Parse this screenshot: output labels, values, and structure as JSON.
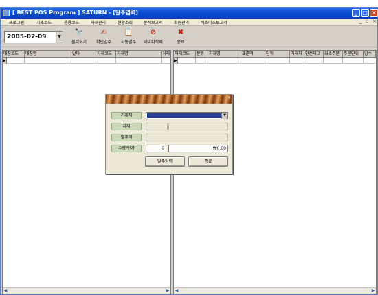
{
  "window": {
    "title": "[ BEST POS Program ]  SATURN  - [발주입력]",
    "controls": {
      "minimize": "_",
      "maximize": "□",
      "close": "×"
    }
  },
  "menu": {
    "items": [
      "프로그램",
      "기초코드",
      "응용코드",
      "자재관리",
      "현황조회",
      "분석보고서",
      "회원관리",
      "비즈니스보고서"
    ],
    "mdi_controls": [
      "_",
      "▫",
      "×"
    ]
  },
  "toolbar": {
    "date_value": "2005-02-09",
    "buttons": [
      {
        "label": "불러오기",
        "icon": "binoculars-icon",
        "glyph": "🔭"
      },
      {
        "label": "확인발주",
        "icon": "check-order-icon",
        "glyph": "✍"
      },
      {
        "label": "자동발주",
        "icon": "auto-order-icon",
        "glyph": "📋"
      },
      {
        "label": "데이타삭제",
        "icon": "delete-data-icon",
        "glyph": "⊘"
      },
      {
        "label": "종료",
        "icon": "exit-icon",
        "glyph": "✖"
      }
    ]
  },
  "left_grid": {
    "columns": [
      "매장코드",
      "매장명",
      "날짜",
      "자재코드",
      "자재명",
      "거래"
    ]
  },
  "right_grid": {
    "columns": [
      "자재코드",
      "분류",
      "자재명",
      "표준액",
      "단위",
      "거래처",
      "안전재고",
      "최소주문",
      "주문단위",
      "입수"
    ]
  },
  "dialog": {
    "close": "×",
    "fields": [
      {
        "label": "거래처"
      },
      {
        "label": "자재"
      },
      {
        "label": "발주액"
      },
      {
        "label": "수량/단가",
        "qty": "0",
        "price": "₩0.00"
      }
    ],
    "buttons": {
      "submit": "발주입력",
      "close": "종료"
    }
  },
  "colors": {
    "titlebar": "#0a4fd4",
    "dialog_title": "#b86a2c",
    "field_label_bg": "#c8d8b8",
    "selection": "#2a3f9a"
  }
}
